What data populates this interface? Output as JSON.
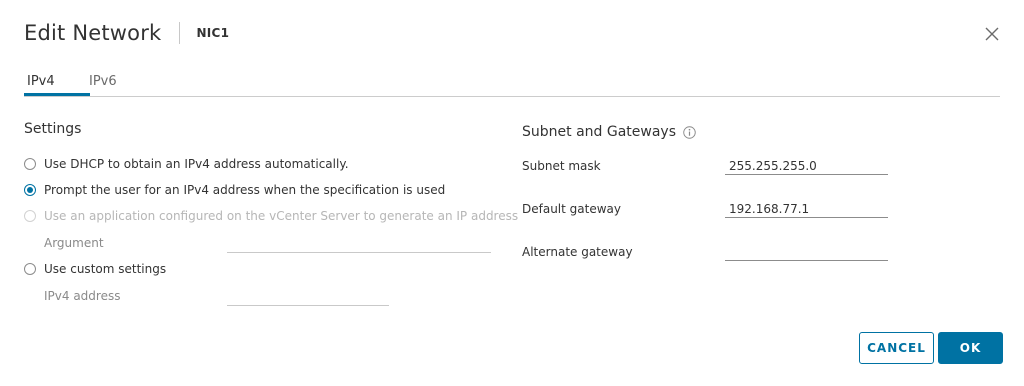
{
  "header": {
    "title": "Edit Network",
    "subtitle": "NIC1"
  },
  "tabs": [
    {
      "label": "IPv4",
      "active": true
    },
    {
      "label": "IPv6",
      "active": false
    }
  ],
  "settings": {
    "title": "Settings",
    "options": [
      {
        "label": "Use DHCP to obtain an IPv4 address automatically.",
        "checked": false,
        "disabled": false
      },
      {
        "label": "Prompt the user for an IPv4 address when the specification is used",
        "checked": true,
        "disabled": false
      },
      {
        "label": "Use an application configured on the vCenter Server to generate an IP address",
        "checked": false,
        "disabled": true
      },
      {
        "label": "Use custom settings",
        "checked": false,
        "disabled": false
      }
    ],
    "argument_label": "Argument",
    "argument_value": "",
    "ipv4_label": "IPv4 address",
    "ipv4_value": ""
  },
  "subnet": {
    "title": "Subnet and Gateways",
    "info_icon": "info-icon",
    "subnet_mask_label": "Subnet mask",
    "subnet_mask_value": "255.255.255.0",
    "default_gateway_label": "Default gateway",
    "default_gateway_value": "192.168.77.1",
    "alternate_gateway_label": "Alternate gateway",
    "alternate_gateway_value": ""
  },
  "footer": {
    "cancel_label": "CANCEL",
    "ok_label": "OK"
  },
  "colors": {
    "accent": "#0072a3",
    "text": "#333333",
    "disabled_text": "#b6b6b6"
  }
}
